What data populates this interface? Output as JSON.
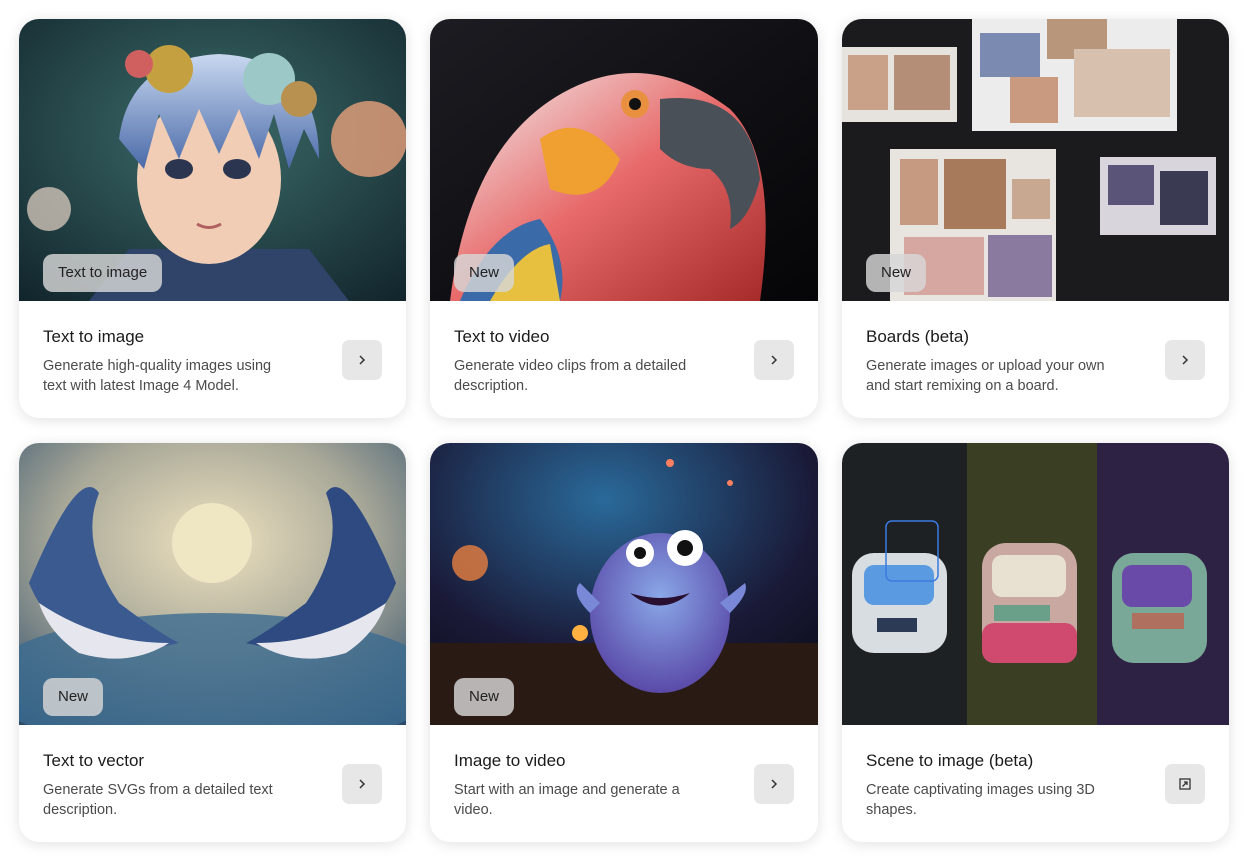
{
  "cards": [
    {
      "title": "Text to image",
      "description": "Generate high-quality images using text with latest Image 4 Model.",
      "badge": "Text to image",
      "action_icon": "chevron-right-icon"
    },
    {
      "title": "Text to video",
      "description": "Generate video clips from a detailed description.",
      "badge": "New",
      "action_icon": "chevron-right-icon"
    },
    {
      "title": "Boards (beta)",
      "description": "Generate images or upload your own and start remixing on a board.",
      "badge": "New",
      "action_icon": "chevron-right-icon"
    },
    {
      "title": "Text to vector",
      "description": "Generate SVGs from a detailed text description.",
      "badge": "New",
      "action_icon": "chevron-right-icon"
    },
    {
      "title": "Image to video",
      "description": "Start with an image and generate a video.",
      "badge": "New",
      "action_icon": "chevron-right-icon"
    },
    {
      "title": "Scene to image (beta)",
      "description": "Create captivating images using 3D shapes.",
      "badge": null,
      "action_icon": "open-external-icon"
    }
  ],
  "colors": {
    "badge_bg": "#d7d7d7",
    "button_bg": "#e7e7e7",
    "text_primary": "#1b1b1b",
    "text_secondary": "#4b4b4b"
  }
}
